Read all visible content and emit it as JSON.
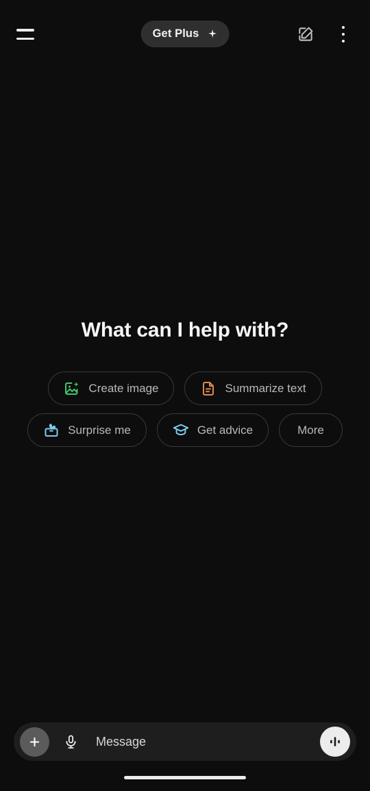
{
  "theme": {
    "background": "#0d0d0d",
    "composer_bg": "#1e1e1e",
    "pill_bg": "#2f2f2f",
    "chip_border": "#3a3a3a",
    "text_primary": "#f5f5f5",
    "text_muted": "#b9b9b9",
    "accent_green": "#3ec96b",
    "accent_orange": "#e08a4b",
    "accent_blue": "#7ecbf0",
    "voice_btn_bg": "#ececec",
    "plus_btn_bg": "#5b5b5b"
  },
  "topbar": {
    "menu_icon": "hamburger-menu-icon",
    "get_plus": {
      "label": "Get Plus",
      "icon": "sparkle-icon"
    },
    "compose_icon": "new-chat-edit-icon",
    "overflow_icon": "kebab-menu-icon"
  },
  "hero": {
    "title": "What can I help with?"
  },
  "suggestions": {
    "rows": [
      [
        {
          "label": "Create image",
          "icon": "image-sparkle-icon",
          "color": "#3ec96b"
        },
        {
          "label": "Summarize text",
          "icon": "document-text-icon",
          "color": "#e08a4b"
        }
      ],
      [
        {
          "label": "Surprise me",
          "icon": "gift-box-icon",
          "color": "#7ecbf0"
        },
        {
          "label": "Get advice",
          "icon": "graduation-cap-icon",
          "color": "#7ecbf0"
        },
        {
          "label": "More",
          "icon": "",
          "color": ""
        }
      ]
    ]
  },
  "composer": {
    "add_icon": "plus-icon",
    "mic_icon": "microphone-icon",
    "input_value": "",
    "input_placeholder": "Message",
    "voice_icon": "voice-waveform-icon"
  },
  "system": {
    "home_indicator": "home-indicator-bar"
  }
}
